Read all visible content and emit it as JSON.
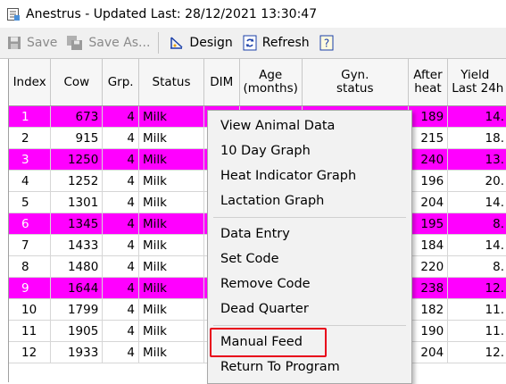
{
  "window": {
    "title": "Anestrus - Updated Last: 28/12/2021 13:30:47"
  },
  "toolbar": {
    "save": "Save",
    "save_as": "Save As...",
    "design": "Design",
    "refresh": "Refresh"
  },
  "columns": {
    "index": "Index",
    "cow": "Cow",
    "grp": "Grp.",
    "status": "Status",
    "dim": "DIM",
    "age_line1": "Age",
    "age_line2": "(months)",
    "gyn_line1": "Gyn.",
    "gyn_line2": "status",
    "after_line1": "After",
    "after_line2": "heat",
    "yield_line1": "Yield",
    "yield_line2": "Last 24h"
  },
  "rows": [
    {
      "index": "1",
      "cow": "673",
      "grp": "4",
      "status": "Milk",
      "after": "189",
      "yield": "14.",
      "highlight": true
    },
    {
      "index": "2",
      "cow": "915",
      "grp": "4",
      "status": "Milk",
      "after": "215",
      "yield": "18.",
      "highlight": false
    },
    {
      "index": "3",
      "cow": "1250",
      "grp": "4",
      "status": "Milk",
      "after": "240",
      "yield": "13.",
      "highlight": true
    },
    {
      "index": "4",
      "cow": "1252",
      "grp": "4",
      "status": "Milk",
      "after": "196",
      "yield": "20.",
      "highlight": false
    },
    {
      "index": "5",
      "cow": "1301",
      "grp": "4",
      "status": "Milk",
      "after": "204",
      "yield": "14.",
      "highlight": false
    },
    {
      "index": "6",
      "cow": "1345",
      "grp": "4",
      "status": "Milk",
      "after": "195",
      "yield": "8.",
      "highlight": true
    },
    {
      "index": "7",
      "cow": "1433",
      "grp": "4",
      "status": "Milk",
      "after": "184",
      "yield": "14.",
      "highlight": false
    },
    {
      "index": "8",
      "cow": "1480",
      "grp": "4",
      "status": "Milk",
      "after": "220",
      "yield": "8.",
      "highlight": false
    },
    {
      "index": "9",
      "cow": "1644",
      "grp": "4",
      "status": "Milk",
      "after": "238",
      "yield": "12.",
      "highlight": true
    },
    {
      "index": "10",
      "cow": "1799",
      "grp": "4",
      "status": "Milk",
      "after": "182",
      "yield": "11.",
      "highlight": false
    },
    {
      "index": "11",
      "cow": "1905",
      "grp": "4",
      "status": "Milk",
      "after": "190",
      "yield": "11.",
      "highlight": false
    },
    {
      "index": "12",
      "cow": "1933",
      "grp": "4",
      "status": "Milk",
      "after": "204",
      "yield": "12.",
      "highlight": false
    }
  ],
  "context_menu": {
    "view_animal_data": "View Animal Data",
    "ten_day_graph": "10 Day Graph",
    "heat_indicator_graph": "Heat Indicator Graph",
    "lactation_graph": "Lactation Graph",
    "data_entry": "Data Entry",
    "set_code": "Set Code",
    "remove_code": "Remove Code",
    "dead_quarter": "Dead Quarter",
    "manual_feed": "Manual Feed",
    "return_to_program": "Return To Program"
  },
  "colors": {
    "row_highlight": "#ff00ff",
    "callout": "#e8001a",
    "menu_bg": "#f2f2f2"
  },
  "icons": [
    "app-report-icon",
    "save-icon",
    "save-as-icon",
    "design-icon",
    "refresh-icon",
    "help-icon"
  ]
}
